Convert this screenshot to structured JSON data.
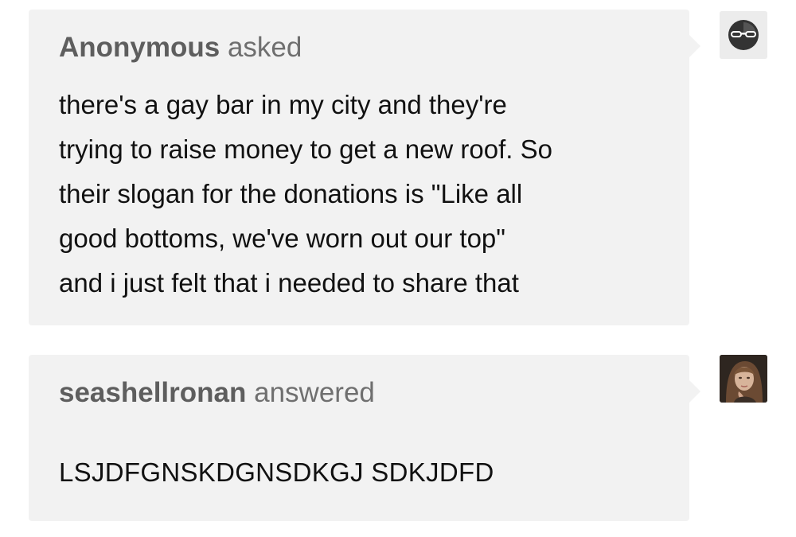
{
  "ask": {
    "asker_name": "Anonymous",
    "asked_word": "asked",
    "lines": [
      "there's a gay bar in my city and they're",
      "trying to raise money to get a new roof. So",
      "their slogan for the donations is \"Like all",
      "good bottoms, we've worn out our top\"",
      "and i just felt that i needed to share that"
    ],
    "avatar_icon": "anonymous-sunglasses-icon"
  },
  "answer": {
    "answerer_name": "seashellronan",
    "answered_word": "answered",
    "text": "LSJDFGNSKDGNSDKGJ SDKJDFD",
    "avatar_icon": "user-photo-avatar"
  },
  "colors": {
    "bubble_bg": "#f2f2f2",
    "header_text": "#6f6f6f",
    "body_text": "#111111"
  }
}
